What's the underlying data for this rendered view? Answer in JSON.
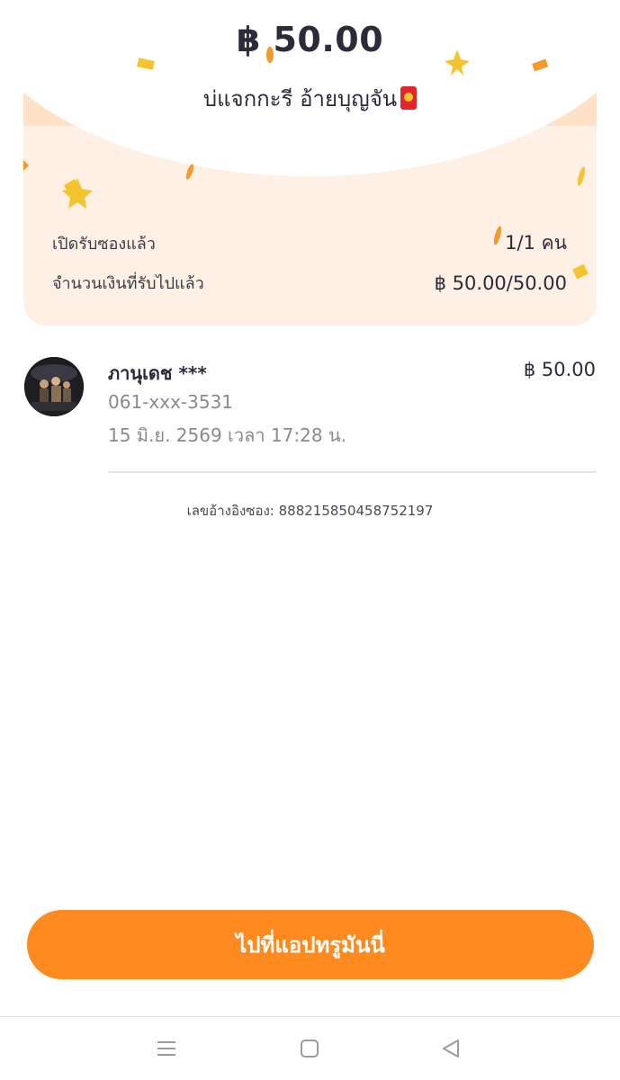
{
  "card": {
    "amount": "฿ 50.00",
    "message": "บ่แจกกะรี อ้ายบุญจัน"
  },
  "stats": {
    "opened_label": "เปิดรับซองแล้ว",
    "opened_value": "1/1 คน",
    "received_label": "จำนวนเงินที่รับไปแล้ว",
    "received_value": "฿ 50.00/50.00"
  },
  "recipient": {
    "name": "ภานุเดช ***",
    "amount": "฿ 50.00",
    "phone": "061-xxx-3531",
    "time": "15 มิ.ย. 2569 เวลา 17:28 น."
  },
  "reference": "เลขอ้างอิงซอง: 888215850458752197",
  "cta_label": "ไปที่แอปทรูมันนี่",
  "colors": {
    "accent": "#ff8a1f",
    "card_bg": "#fff0e6",
    "confetti_gold": "#f4c430",
    "confetti_orange": "#f39a2c"
  },
  "nav_icons": [
    "menu-icon",
    "home-square-icon",
    "back-triangle-icon"
  ]
}
